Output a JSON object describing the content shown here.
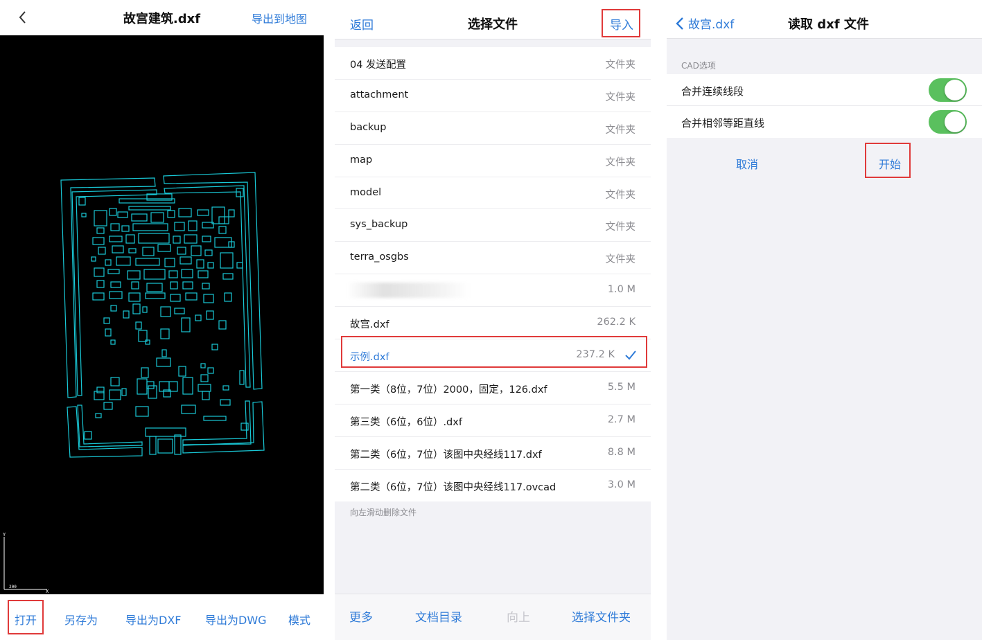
{
  "viewer": {
    "title": "故宫建筑.dxf",
    "export_to_map": "导出到地图",
    "axis_y": "Y",
    "axis_x": "X",
    "scale_label": "200",
    "toolbar": [
      "打开",
      "另存为",
      "导出为DXF",
      "导出为DWG",
      "模式"
    ]
  },
  "file_picker": {
    "back": "返回",
    "title": "选择文件",
    "import": "导入",
    "files": [
      {
        "name": "04 发送配置",
        "meta": "文件夹"
      },
      {
        "name": "attachment",
        "meta": "文件夹"
      },
      {
        "name": "backup",
        "meta": "文件夹"
      },
      {
        "name": "map",
        "meta": "文件夹"
      },
      {
        "name": "model",
        "meta": "文件夹"
      },
      {
        "name": "sys_backup",
        "meta": "文件夹"
      },
      {
        "name": "terra_osgbs",
        "meta": "文件夹"
      },
      {
        "name": "",
        "meta": "1.0 M"
      },
      {
        "name": "故宫.dxf",
        "meta": "262.2 K"
      },
      {
        "name": "示例.dxf",
        "meta": "237.2 K"
      },
      {
        "name": "第一类（8位，7位）2000，固定，126.dxf",
        "meta": "5.5 M"
      },
      {
        "name": "第三类（6位，6位）.dxf",
        "meta": "2.7 M"
      },
      {
        "name": "第二类（6位，7位）该图中央经线117.dxf",
        "meta": "8.8 M"
      },
      {
        "name": "第二类（6位，7位）该图中央经线117.ovcad",
        "meta": "3.0 M"
      }
    ],
    "hint": "向左滑动删除文件",
    "toolbar": [
      "更多",
      "文档目录",
      "向上",
      "选择文件夹"
    ]
  },
  "dxf_options": {
    "back": "故宫.dxf",
    "title": "读取 dxf 文件",
    "section": "CAD选项",
    "options": [
      {
        "label": "合并连续线段",
        "on": true
      },
      {
        "label": "合并相邻等距直线",
        "on": true
      }
    ],
    "cancel": "取消",
    "start": "开始"
  },
  "colors": {
    "accent": "#2f7bd8",
    "highlight": "#e03a3a",
    "cad_line": "#19c8d6",
    "toggle_on": "#5ac05e"
  }
}
